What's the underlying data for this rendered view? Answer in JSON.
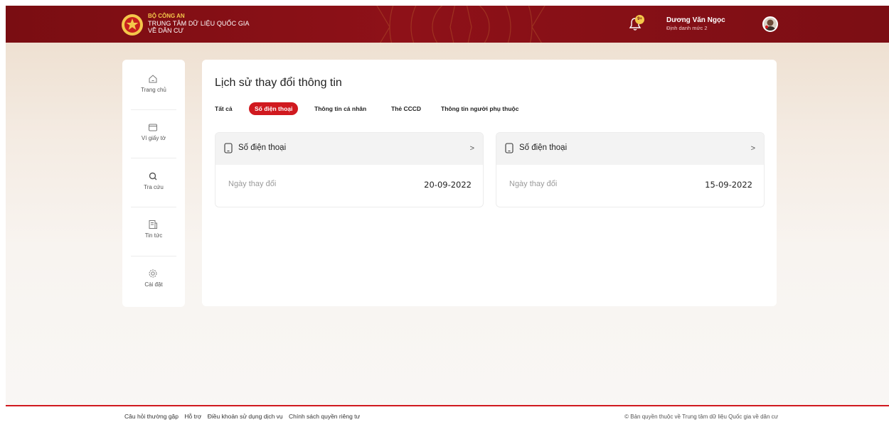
{
  "header": {
    "org_line1": "BỘ CÔNG AN",
    "org_line2": "TRUNG TÂM DỮ LIỆU QUỐC GIA",
    "org_line3": "VỀ DÂN CƯ",
    "notification_badge": "9+",
    "user_name": "Dương Văn Ngọc",
    "user_role": "Định danh mức 2"
  },
  "sidebar": {
    "items": [
      {
        "label": "Trang chủ",
        "icon": "home-icon"
      },
      {
        "label": "Ví giấy tờ",
        "icon": "wallet-icon"
      },
      {
        "label": "Tra cứu",
        "icon": "search-icon"
      },
      {
        "label": "Tin tức",
        "icon": "news-icon"
      },
      {
        "label": "Cài đặt",
        "icon": "settings-icon"
      }
    ]
  },
  "main": {
    "title": "Lịch sử thay đổi thông tin",
    "tabs": [
      {
        "label": "Tất cả"
      },
      {
        "label": "Số điện thoại",
        "active": true
      },
      {
        "label": "Thông tin cá nhân"
      },
      {
        "label": "Thẻ CCCD"
      },
      {
        "label": "Thông tin người phụ thuộc"
      }
    ],
    "cards": [
      {
        "title": "Số điện thoại",
        "label": "Ngày thay đổi",
        "date": "20-09-2022"
      },
      {
        "title": "Số điện thoại",
        "label": "Ngày thay đổi",
        "date": "15-09-2022"
      }
    ]
  },
  "footer": {
    "links": [
      "Câu hỏi thường gặp",
      "Hỗ trợ",
      "Điều khoản sử dụng dịch vụ",
      "Chính sách quyền riêng tư"
    ],
    "copyright": "© Bản quyền thuộc về Trung tâm dữ liệu Quốc gia về dân cư"
  },
  "colors": {
    "brand_red": "#d0191f",
    "header_red": "#8e1118",
    "gold": "#f4c74a"
  }
}
